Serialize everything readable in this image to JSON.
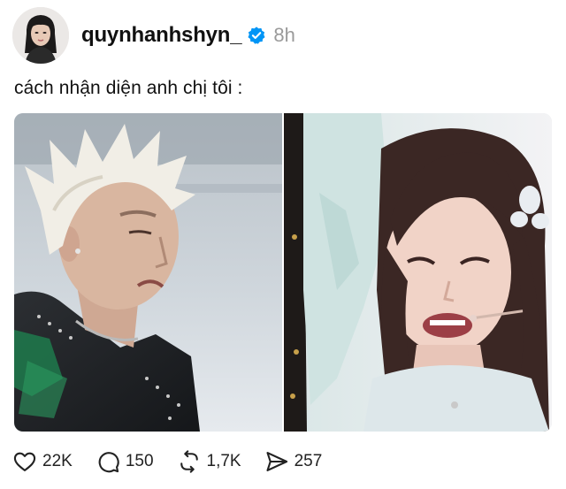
{
  "post": {
    "author": {
      "username": "quynhanhshyn_",
      "verified": true
    },
    "timestamp": "8h",
    "caption": "cách nhận diện anh chị tôi :",
    "media": [
      {
        "description": "photo-left"
      },
      {
        "description": "photo-right"
      }
    ],
    "actions": {
      "like_count": "22K",
      "comment_count": "150",
      "repost_count": "1,7K",
      "share_count": "257"
    }
  },
  "colors": {
    "verified_badge": "#0095f6",
    "timestamp": "#9a9a9a",
    "text": "#111111"
  },
  "icons": [
    "heart-icon",
    "comment-icon",
    "repost-icon",
    "share-icon",
    "verified-badge-icon"
  ]
}
